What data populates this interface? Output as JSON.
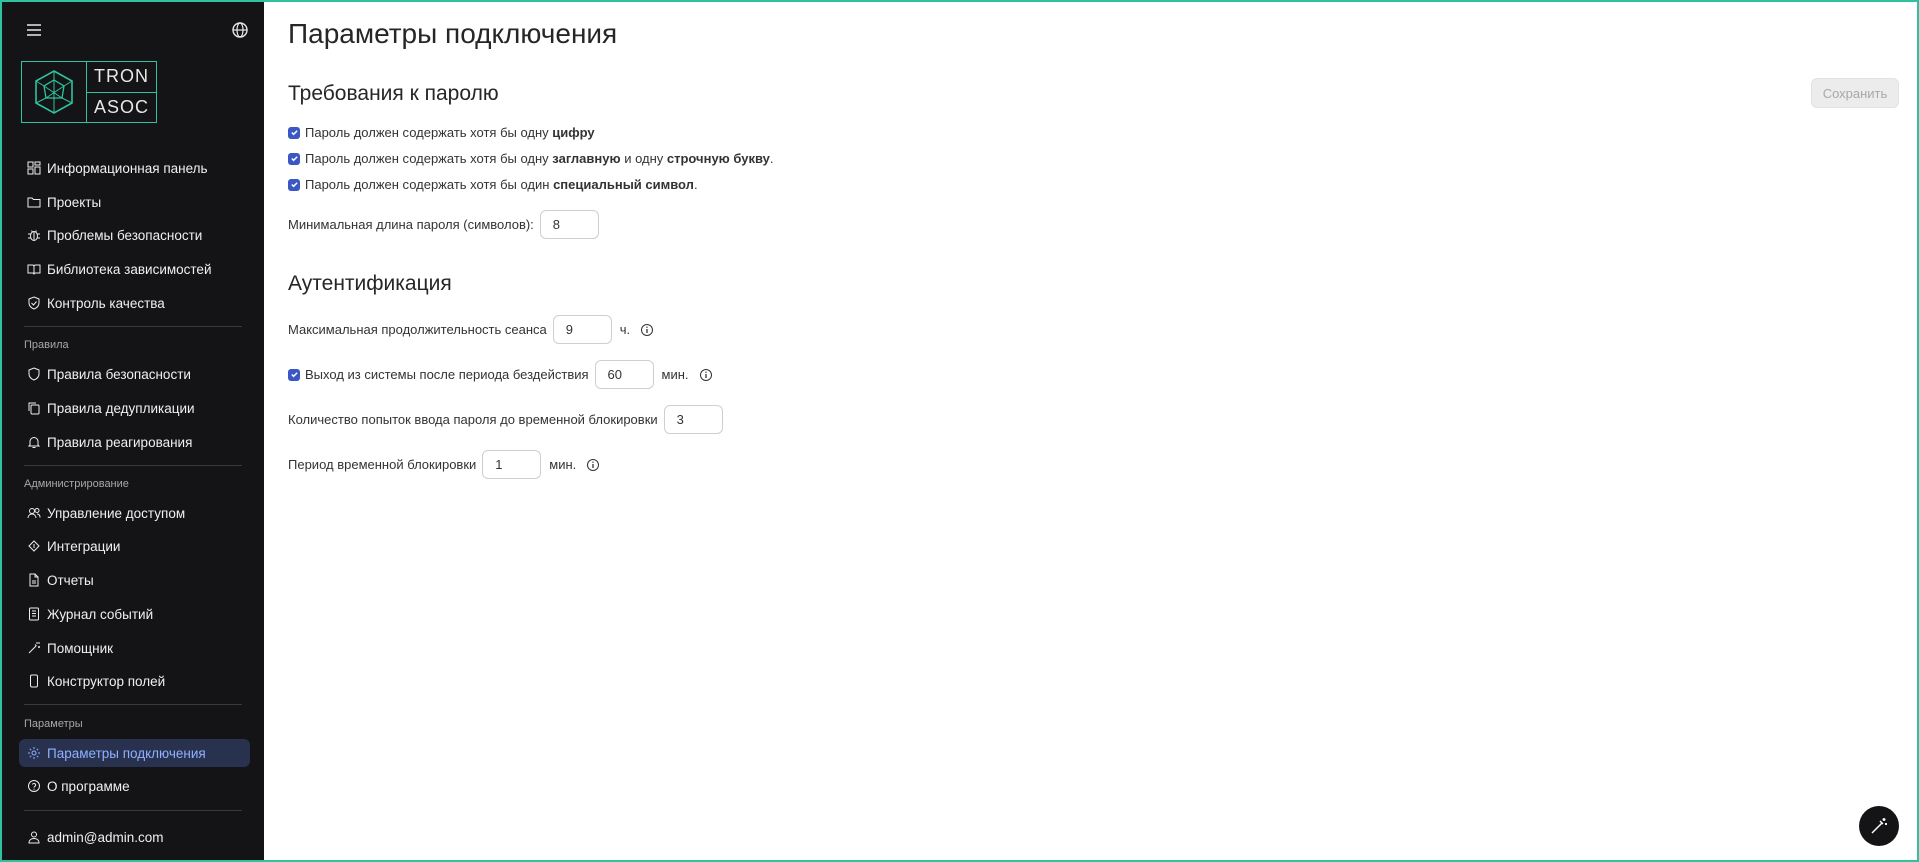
{
  "logo": {
    "line1": "TRON",
    "line2": "ASOC"
  },
  "nav": {
    "main_items": [
      {
        "label": "Информационная панель",
        "icon": "dashboard-icon"
      },
      {
        "label": "Проекты",
        "icon": "folder-icon"
      },
      {
        "label": "Проблемы безопасности",
        "icon": "bug-icon"
      },
      {
        "label": "Библиотека зависимостей",
        "icon": "book-icon"
      },
      {
        "label": "Контроль качества",
        "icon": "shield-check-icon"
      }
    ],
    "rules_section": "Правила",
    "rules_items": [
      {
        "label": "Правила безопасности",
        "icon": "shield-icon"
      },
      {
        "label": "Правила дедупликации",
        "icon": "copy-icon"
      },
      {
        "label": "Правила реагирования",
        "icon": "bell-icon"
      }
    ],
    "admin_section": "Администрирование",
    "admin_items": [
      {
        "label": "Управление доступом",
        "icon": "users-icon"
      },
      {
        "label": "Интеграции",
        "icon": "integrations-icon"
      },
      {
        "label": "Отчеты",
        "icon": "report-icon"
      },
      {
        "label": "Журнал событий",
        "icon": "log-icon"
      },
      {
        "label": "Помощник",
        "icon": "wand-icon"
      },
      {
        "label": "Конструктор полей",
        "icon": "device-icon"
      }
    ],
    "params_section": "Параметры",
    "params_items": [
      {
        "label": "Параметры подключения",
        "icon": "gear-icon",
        "active": true
      },
      {
        "label": "О программе",
        "icon": "help-icon"
      }
    ],
    "user": "admin@admin.com"
  },
  "page": {
    "title": "Параметры подключения",
    "save_label": "Сохранить"
  },
  "password": {
    "heading": "Требования к паролю",
    "req_digit": {
      "pre": "Пароль должен содержать хотя бы одну ",
      "bold": "цифру",
      "checked": true
    },
    "req_case": {
      "pre": "Пароль должен содержать хотя бы одну ",
      "bold1": "заглавную",
      "mid": " и одну ",
      "bold2": "строчную букву",
      "post": ".",
      "checked": true
    },
    "req_special": {
      "pre": "Пароль должен содержать хотя бы один ",
      "bold": "специальный символ",
      "post": ".",
      "checked": true
    },
    "min_length_label": "Минимальная длина пароля (символов):",
    "min_length_value": "8"
  },
  "auth": {
    "heading": "Аутентификация",
    "session_label": "Максимальная продолжительность сеанса",
    "session_value": "9",
    "session_unit": "ч.",
    "idle_label": "Выход из системы после периода бездействия",
    "idle_value": "60",
    "idle_unit": "мин.",
    "idle_checked": true,
    "attempts_label": "Количество попыток ввода пароля до временной блокировки",
    "attempts_value": "3",
    "lock_label": "Период временной блокировки",
    "lock_value": "1",
    "lock_unit": "мин."
  },
  "colors": {
    "accent": "#2fc2a0",
    "sidebar_bg": "#141416",
    "checkbox": "#3b57c4",
    "active_bg": "#28324f",
    "active_text": "#8fb0ff"
  }
}
